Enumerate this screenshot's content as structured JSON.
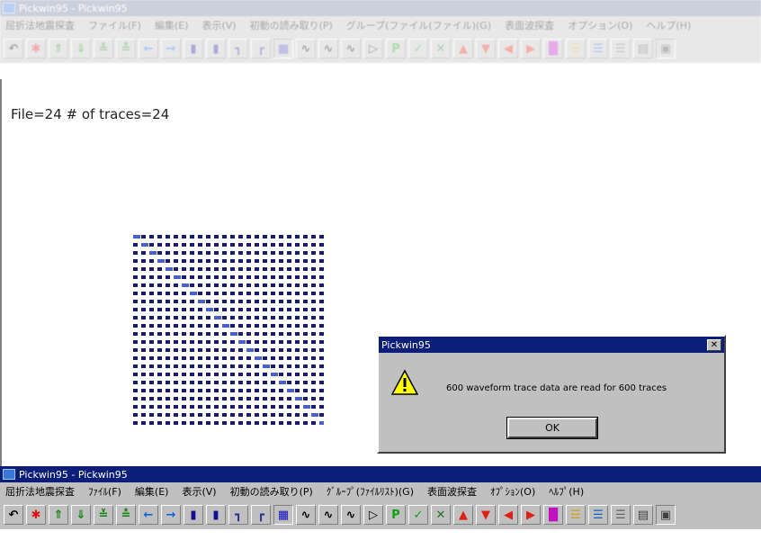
{
  "top_window": {
    "title": "Pickwin95 - Pickwin95",
    "menu": [
      "屈折法地震探査",
      "ファイル(F)",
      "編集(E)",
      "表示(V)",
      "初動の読み取り(P)",
      "グループ(ファイル(ファイル)(G)",
      "表面波探査",
      "オプション(O)",
      "ヘルプ(H)"
    ]
  },
  "file_info": "File=24 # of traces=24",
  "trace_grid": {
    "rows": 24,
    "cols": 24,
    "dot_color": "#1a1a6e",
    "diag_color": "#4a5fd0"
  },
  "dialog": {
    "title": "Pickwin95",
    "message": "600 waveform trace data are read for 600 traces",
    "ok_label": "OK"
  },
  "bottom_window": {
    "title": "Pickwin95 - Pickwin95",
    "menu": [
      "屈折法地震探査",
      "ﾌｧｲﾙ(F)",
      "編集(E)",
      "表示(V)",
      "初動の読み取り(P)",
      "ｸﾞﾙｰﾌﾟ(ﾌｧｲﾙﾘｽﾄ)(G)",
      "表面波探査",
      "ｵﾌﾟｼｮﾝ(O)",
      "ﾍﾙﾌﾟ(H)"
    ]
  },
  "toolbar_icons": [
    {
      "name": "undo-icon",
      "glyph": "↶",
      "color": "#000000"
    },
    {
      "name": "star-icon",
      "glyph": "✱",
      "color": "#e01010"
    },
    {
      "name": "arrow-up-icon",
      "glyph": "⇑",
      "color": "#108010"
    },
    {
      "name": "arrow-down-icon",
      "glyph": "⇓",
      "color": "#108010"
    },
    {
      "name": "converge-icon",
      "glyph": "≚",
      "color": "#108010"
    },
    {
      "name": "diverge-icon",
      "glyph": "≛",
      "color": "#108010"
    },
    {
      "name": "arrow-left-icon",
      "glyph": "←",
      "color": "#1060e0"
    },
    {
      "name": "arrow-right-icon",
      "glyph": "→",
      "color": "#1060e0"
    },
    {
      "name": "book-icon",
      "glyph": "▮",
      "color": "#101090"
    },
    {
      "name": "book2-icon",
      "glyph": "▮",
      "color": "#101090"
    },
    {
      "name": "step-icon",
      "glyph": "┓",
      "color": "#303090"
    },
    {
      "name": "step2-icon",
      "glyph": "┏",
      "color": "#303090"
    },
    {
      "name": "grid-icon",
      "glyph": "▦",
      "color": "#1010c0"
    },
    {
      "name": "wave-icon",
      "glyph": "∿",
      "color": "#000000"
    },
    {
      "name": "wave-a-icon",
      "glyph": "∿",
      "color": "#000000"
    },
    {
      "name": "wave-b-icon",
      "glyph": "∿",
      "color": "#000000"
    },
    {
      "name": "pointer-icon",
      "glyph": "▷",
      "color": "#000000"
    },
    {
      "name": "p-icon",
      "glyph": "P",
      "color": "#10a010"
    },
    {
      "name": "check-icon",
      "glyph": "✓",
      "color": "#10a010"
    },
    {
      "name": "x-icon",
      "glyph": "✕",
      "color": "#207020"
    },
    {
      "name": "tri-up-icon",
      "glyph": "▲",
      "color": "#e02010"
    },
    {
      "name": "tri-down-icon",
      "glyph": "▼",
      "color": "#e02010"
    },
    {
      "name": "tri-left-icon",
      "glyph": "◀",
      "color": "#e02010"
    },
    {
      "name": "tri-right-icon",
      "glyph": "▶",
      "color": "#e02010"
    },
    {
      "name": "gradient-icon",
      "glyph": "█",
      "color": "#c010c0"
    },
    {
      "name": "lines-icon",
      "glyph": "☰",
      "color": "#d0a000"
    },
    {
      "name": "lines2-icon",
      "glyph": "☰",
      "color": "#1060c0"
    },
    {
      "name": "lines3-icon",
      "glyph": "☰",
      "color": "#606060"
    },
    {
      "name": "panel-icon",
      "glyph": "▤",
      "color": "#404040"
    },
    {
      "name": "panel2-icon",
      "glyph": "▣",
      "color": "#404040"
    }
  ],
  "colors": {
    "title_bg": "#0a1e7a",
    "title_bg_faded": "#9aa0ba",
    "face": "#c0c0c0"
  }
}
